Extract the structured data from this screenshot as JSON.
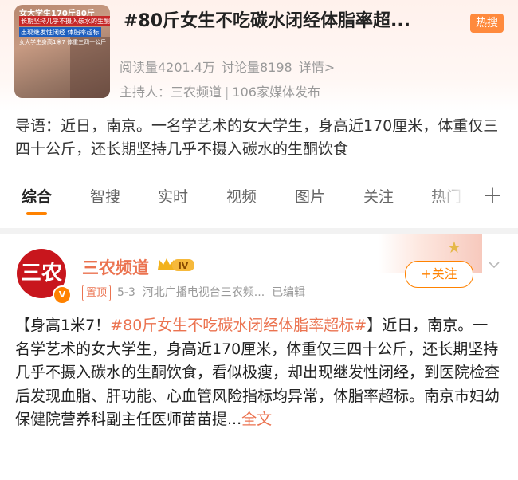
{
  "topic": {
    "thumb_lines": [
      "女大学生170斤80斤",
      "长期坚持几乎不摄入碳水的生酮饮食",
      "出现继发性闭经 体脂率超标",
      "女大学生身高1米7 体重三四十公斤"
    ],
    "title": "#80斤女生不吃碳水闭经体脂率超...",
    "hot_badge": "热搜",
    "read_count": "阅读量4201.4万",
    "discuss_count": "讨论量8198",
    "detail_link": "详情>",
    "host_label": "主持人：三农频道",
    "media_count": "106家媒体发布"
  },
  "intro": {
    "text": "导语：近日，南京。一名学艺术的女大学生，身高近170厘米，体重仅三四十公斤，还长期坚持几乎不摄入碳水的生酮饮食"
  },
  "tabs": [
    "综合",
    "智搜",
    "实时",
    "视频",
    "图片",
    "关注",
    "热门"
  ],
  "post": {
    "avatar_text": "三农",
    "author": "三农频道",
    "level": "IV",
    "pin_label": "置顶",
    "date": "5-3",
    "source": "河北广播电视台三农频...",
    "edited": "已编辑",
    "follow_label": "+关注",
    "body_prefix": "【身高1米7！",
    "body_hashtag": "#80斤女生不吃碳水闭经体脂率超标#",
    "body_main": "】近日，南京。一名学艺术的女大学生，身高近170厘米，体重仅三四十公斤，还长期坚持几乎不摄入碳水的生酮饮食，看似极瘦，却出现继发性闭经，到医院检查后发现血脂、肝功能、心血管风险指标均异常，体脂率超标。南京市妇幼保健院营养科副主任医师苗苗提...",
    "full_text_link": "全文"
  },
  "colors": {
    "accent": "#ff8200",
    "link": "#eb7350",
    "hot": "#ff8a3d"
  }
}
